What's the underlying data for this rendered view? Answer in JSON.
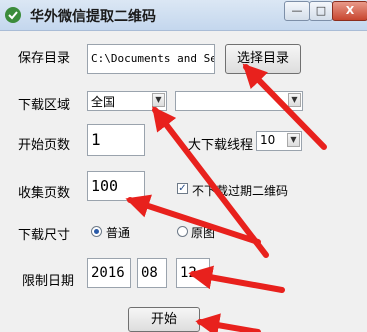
{
  "window": {
    "title": "华外微信提取二维码",
    "minimize_label": "—",
    "maximize_label": "□",
    "close_label": "X"
  },
  "save_dir": {
    "label": "保存目录",
    "value": "C:\\Documents and Sett",
    "button": "选择目录"
  },
  "region": {
    "label": "下载区域",
    "selected": "全国",
    "second_selected": ""
  },
  "start_page": {
    "label": "开始页数",
    "value": "1"
  },
  "max_threads": {
    "label": "最大下载线程",
    "label_visible": "大下载线程",
    "selected": "10"
  },
  "collect_pages": {
    "label": "收集页数",
    "value": "100"
  },
  "skip_expired": {
    "label": "不下载过期二维码",
    "checked": true
  },
  "size": {
    "label": "下载尺寸",
    "options": [
      "普通",
      "原图"
    ],
    "selected": "普通"
  },
  "date_limit": {
    "label": "限制日期",
    "year": "2016",
    "month": "08",
    "day": "12"
  },
  "start_button": "开始",
  "annotation_color": "#e8211d"
}
